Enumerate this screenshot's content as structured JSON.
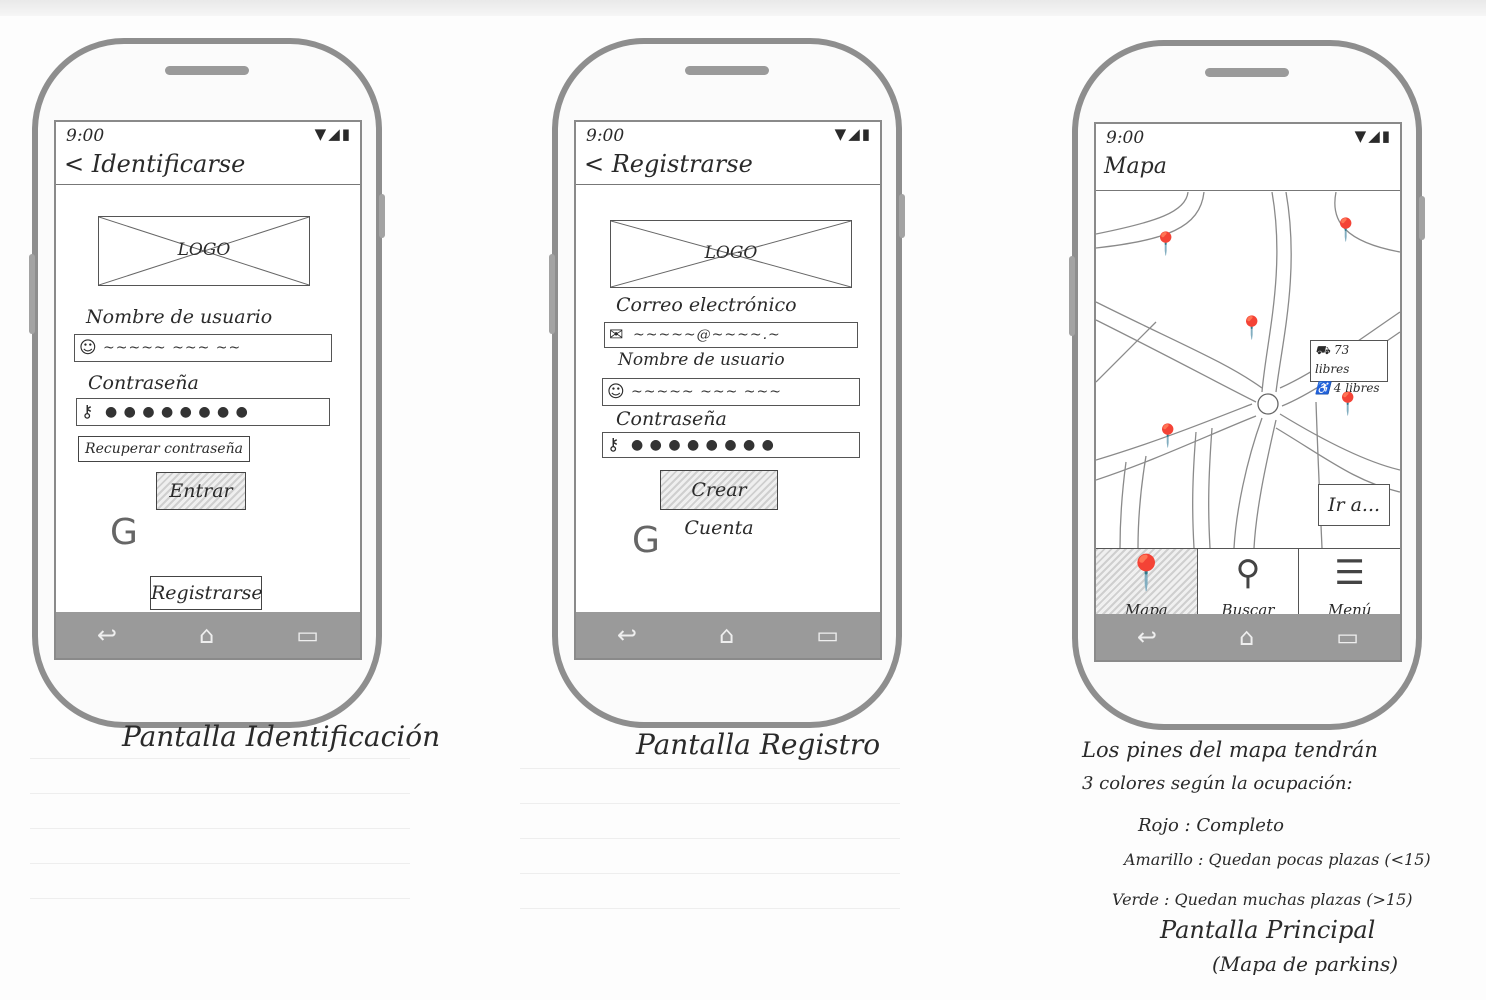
{
  "captions": {
    "login": "Pantalla Identificación",
    "register": "Pantalla Registro",
    "main": "Pantalla Principal",
    "main_sub": "(Mapa de parkins)"
  },
  "notes": [
    "Los pines del mapa tendrán",
    "3 colores según la ocupación:",
    "Rojo : Completo",
    "Amarillo : Quedan pocas plazas (<15)",
    "Verde : Quedan muchas plazas (>15)"
  ],
  "status": {
    "time": "9:00",
    "icons": "▼◢▮"
  },
  "nav": {
    "back": "↩",
    "home": "⌂",
    "recents": "▭"
  },
  "login": {
    "title": "< Identificarse",
    "logo": "LOGO",
    "username_label": "Nombre de usuario",
    "username_value": "~~~~~ ~~~ ~~",
    "password_label": "Contraseña",
    "password_value": "● ● ● ● ● ● ● ●",
    "recover": "Recuperar contraseña",
    "enter": "Entrar",
    "google": "G",
    "apple": "",
    "register": "Registrarse"
  },
  "register": {
    "title": "< Registrarse",
    "logo": "LOGO",
    "email_label": "Correo electrónico",
    "email_value": "~~~~~@~~~~.~",
    "username_label": "Nombre de usuario",
    "username_value": "~~~~~ ~~~ ~~~",
    "password_label": "Contraseña",
    "password_value": "● ● ● ● ● ● ● ●",
    "create": "Crear Cuenta",
    "google": "G",
    "apple": ""
  },
  "main": {
    "title": "Mapa",
    "popup_cars": "73 libres",
    "popup_bikes": "4 libres",
    "go": "Ir a...",
    "tab_map": "Mapa",
    "tab_search": "Buscar",
    "tab_menu": "Menú"
  },
  "icons": {
    "user": "☺",
    "key": "⚷",
    "mail": "✉",
    "pin": "📍",
    "search": "⚲",
    "menu": "☰",
    "car": "⛟",
    "bike": "♿"
  }
}
